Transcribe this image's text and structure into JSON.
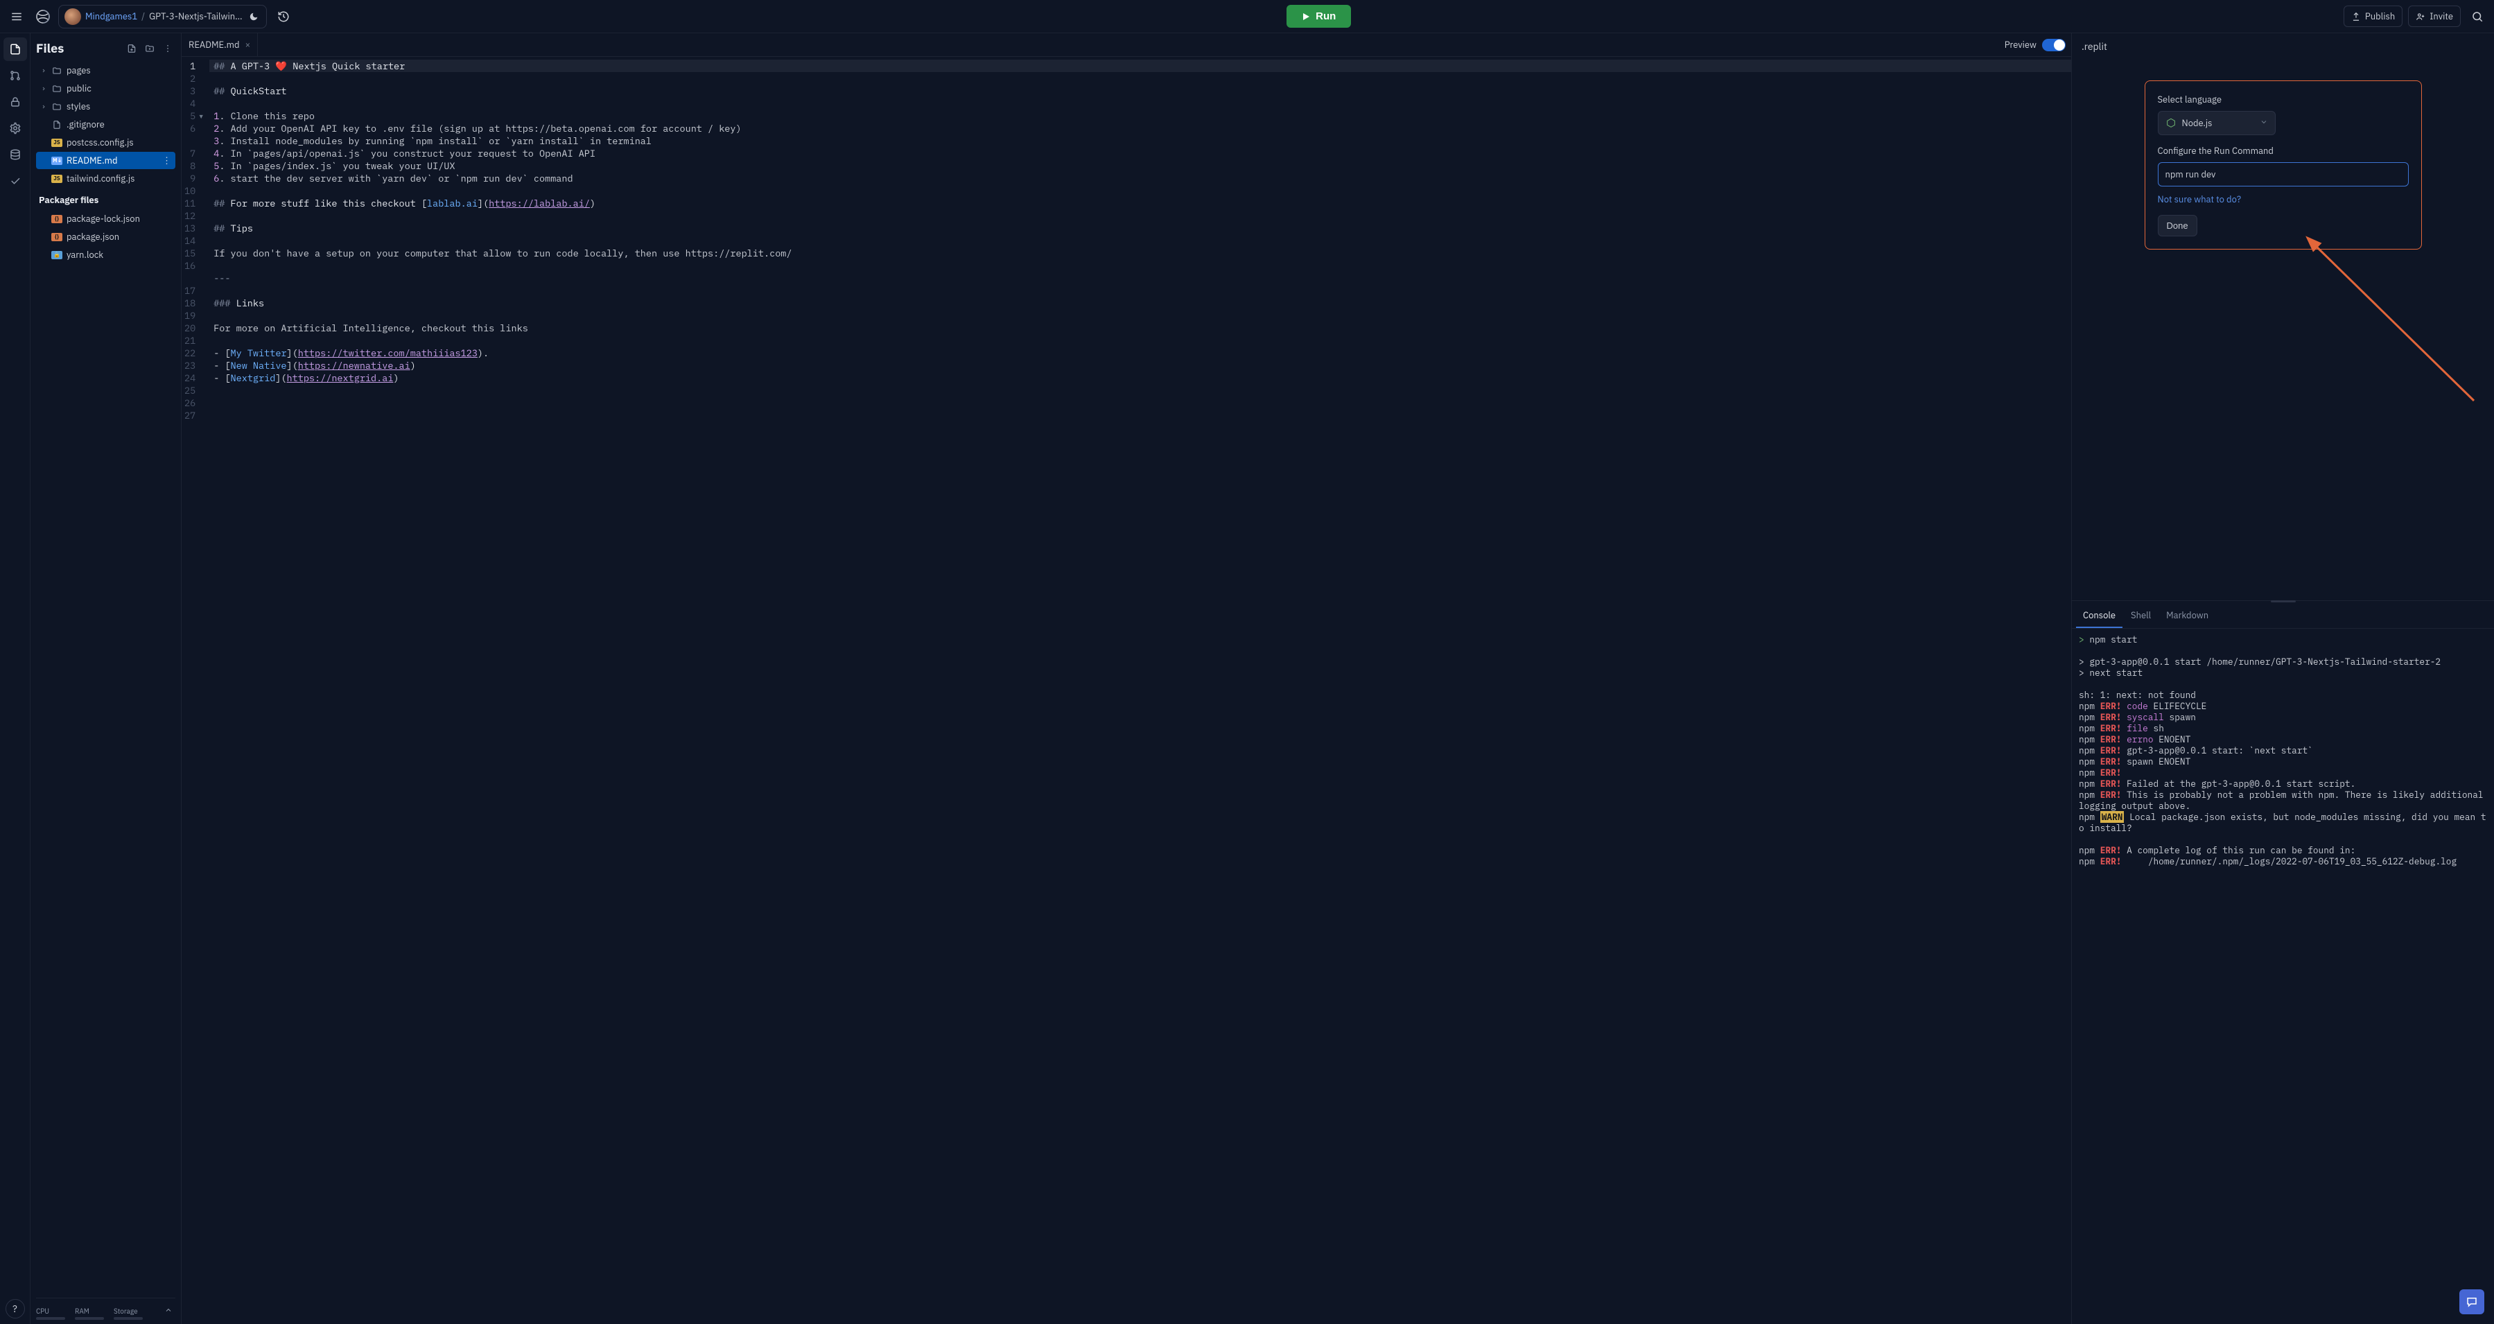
{
  "header": {
    "user": "Mindgames1",
    "repo": "GPT-3-Nextjs-Tailwin…",
    "run": "Run",
    "publish": "Publish",
    "invite": "Invite"
  },
  "files": {
    "title": "Files",
    "folders": [
      "pages",
      "public",
      "styles"
    ],
    "loose": [
      {
        "name": ".gitignore",
        "badge": "",
        "kind": "plain"
      },
      {
        "name": "postcss.config.js",
        "badge": "JS",
        "kind": "js"
      },
      {
        "name": "README.md",
        "badge": "M↓",
        "kind": "md",
        "selected": true
      },
      {
        "name": "tailwind.config.js",
        "badge": "JS",
        "kind": "js"
      }
    ],
    "packager_label": "Packager files",
    "packager": [
      {
        "name": "package-lock.json",
        "badge": "{}",
        "kind": "json"
      },
      {
        "name": "package.json",
        "badge": "{}",
        "kind": "json"
      },
      {
        "name": "yarn.lock",
        "badge": "🔒",
        "kind": "lock"
      }
    ],
    "footer": {
      "cpu": "CPU",
      "ram": "RAM",
      "storage": "Storage"
    }
  },
  "editor": {
    "tab": "README.md",
    "preview": "Preview",
    "lines": [
      {
        "n": 1,
        "segs": [
          {
            "t": "## ",
            "c": "c-mk"
          },
          {
            "t": "A GPT-3 ",
            "c": "c-head"
          },
          {
            "t": "❤️",
            "c": "heart"
          },
          {
            "t": " Nextjs Quick starter",
            "c": "c-head"
          }
        ],
        "cur": true
      },
      {
        "n": 2,
        "segs": []
      },
      {
        "n": 3,
        "segs": [
          {
            "t": "## ",
            "c": "c-mk"
          },
          {
            "t": "QuickStart",
            "c": "c-head"
          }
        ]
      },
      {
        "n": 4,
        "segs": []
      },
      {
        "n": 5,
        "segs": [
          {
            "t": "1",
            "c": "c-num"
          },
          {
            "t": ". Clone this repo",
            "c": ""
          }
        ],
        "fold": true
      },
      {
        "n": 6,
        "segs": [
          {
            "t": "2",
            "c": "c-num"
          },
          {
            "t": ". Add your OpenAI API key to .env file (sign up at https://beta.openai.com for account / key)",
            "c": ""
          }
        ],
        "wrap": true
      },
      {
        "n": 7,
        "segs": [
          {
            "t": "3",
            "c": "c-num"
          },
          {
            "t": ". Install node_modules by running `npm install` or `yarn install` in terminal",
            "c": ""
          }
        ]
      },
      {
        "n": 8,
        "segs": [
          {
            "t": "4",
            "c": "c-num"
          },
          {
            "t": ". In `pages/api/openai.js` you construct your request to OpenAI API",
            "c": ""
          }
        ]
      },
      {
        "n": 9,
        "segs": [
          {
            "t": "5",
            "c": "c-num"
          },
          {
            "t": ". In `pages/index.js` you tweak your UI/UX",
            "c": ""
          }
        ]
      },
      {
        "n": 10,
        "segs": [
          {
            "t": "6",
            "c": "c-num"
          },
          {
            "t": ". start the dev server with `yarn dev` or `npm run dev` command",
            "c": ""
          }
        ]
      },
      {
        "n": 11,
        "segs": []
      },
      {
        "n": 12,
        "segs": [
          {
            "t": "## ",
            "c": "c-mk"
          },
          {
            "t": "For more stuff like this checkout ",
            "c": "c-head"
          },
          {
            "t": "[",
            "c": "c-br"
          },
          {
            "t": "lablab.ai",
            "c": "c-linktext"
          },
          {
            "t": "](",
            "c": "c-br"
          },
          {
            "t": "https://lablab.ai/",
            "c": "c-link"
          },
          {
            "t": ")",
            "c": "c-br"
          }
        ]
      },
      {
        "n": 13,
        "segs": []
      },
      {
        "n": 14,
        "segs": [
          {
            "t": "## ",
            "c": "c-mk"
          },
          {
            "t": "Tips",
            "c": "c-head"
          }
        ]
      },
      {
        "n": 15,
        "segs": []
      },
      {
        "n": 16,
        "segs": [
          {
            "t": "If you don't have a setup on your computer that allow to run code locally, then use https://replit.com/",
            "c": ""
          }
        ],
        "wrap": true
      },
      {
        "n": 17,
        "segs": []
      },
      {
        "n": 18,
        "segs": [
          {
            "t": "---",
            "c": "c-mk"
          }
        ]
      },
      {
        "n": 19,
        "segs": []
      },
      {
        "n": 20,
        "segs": [
          {
            "t": "### ",
            "c": "c-mk"
          },
          {
            "t": "Links",
            "c": "c-head"
          }
        ]
      },
      {
        "n": 21,
        "segs": []
      },
      {
        "n": 22,
        "segs": [
          {
            "t": "For more on Artificial Intelligence, checkout this links",
            "c": ""
          }
        ]
      },
      {
        "n": 23,
        "segs": []
      },
      {
        "n": 24,
        "segs": [
          {
            "t": "- ",
            "c": ""
          },
          {
            "t": "[",
            "c": "c-br"
          },
          {
            "t": "My Twitter",
            "c": "c-linktext"
          },
          {
            "t": "](",
            "c": "c-br"
          },
          {
            "t": "https://twitter.com/mathiiias123",
            "c": "c-link"
          },
          {
            "t": ")",
            "c": "c-br"
          },
          {
            "t": ".",
            "c": ""
          }
        ]
      },
      {
        "n": 25,
        "segs": [
          {
            "t": "- ",
            "c": ""
          },
          {
            "t": "[",
            "c": "c-br"
          },
          {
            "t": "New Native",
            "c": "c-linktext"
          },
          {
            "t": "](",
            "c": "c-br"
          },
          {
            "t": "https://newnative.ai",
            "c": "c-link"
          },
          {
            "t": ")",
            "c": "c-br"
          }
        ]
      },
      {
        "n": 26,
        "segs": [
          {
            "t": "- ",
            "c": ""
          },
          {
            "t": "[",
            "c": "c-br"
          },
          {
            "t": "Nextgrid",
            "c": "c-linktext"
          },
          {
            "t": "](",
            "c": "c-br"
          },
          {
            "t": "https://nextgrid.ai",
            "c": "c-link"
          },
          {
            "t": ")",
            "c": "c-br"
          }
        ]
      },
      {
        "n": 27,
        "segs": []
      }
    ]
  },
  "replit": {
    "tab": ".replit",
    "select_label": "Select language",
    "language": "Node.js",
    "configure_label": "Configure the Run Command",
    "run_command": "npm run dev",
    "help": "Not sure what to do?",
    "done": "Done"
  },
  "console": {
    "tabs": [
      "Console",
      "Shell",
      "Markdown"
    ],
    "lines": [
      {
        "segs": [
          {
            "t": "> ",
            "c": "prompt-ch"
          },
          {
            "t": "npm start"
          }
        ]
      },
      {
        "segs": []
      },
      {
        "segs": [
          {
            "t": "> gpt-3-app@0.0.1 start /home/runner/GPT-3-Nextjs-Tailwind-starter-2"
          }
        ]
      },
      {
        "segs": [
          {
            "t": "> next start"
          }
        ]
      },
      {
        "segs": []
      },
      {
        "segs": [
          {
            "t": "sh: 1: next: not found"
          }
        ]
      },
      {
        "segs": [
          {
            "t": "npm "
          },
          {
            "t": "ERR!",
            "c": "err"
          },
          {
            "t": " "
          },
          {
            "t": "code",
            "c": "errkey"
          },
          {
            "t": " ELIFECYCLE"
          }
        ]
      },
      {
        "segs": [
          {
            "t": "npm "
          },
          {
            "t": "ERR!",
            "c": "err"
          },
          {
            "t": " "
          },
          {
            "t": "syscall",
            "c": "errkey"
          },
          {
            "t": " spawn"
          }
        ]
      },
      {
        "segs": [
          {
            "t": "npm "
          },
          {
            "t": "ERR!",
            "c": "err"
          },
          {
            "t": " "
          },
          {
            "t": "file",
            "c": "errkey"
          },
          {
            "t": " sh"
          }
        ]
      },
      {
        "segs": [
          {
            "t": "npm "
          },
          {
            "t": "ERR!",
            "c": "err"
          },
          {
            "t": " "
          },
          {
            "t": "errno",
            "c": "errkey"
          },
          {
            "t": " ENOENT"
          }
        ]
      },
      {
        "segs": [
          {
            "t": "npm "
          },
          {
            "t": "ERR!",
            "c": "err"
          },
          {
            "t": " gpt-3-app@0.0.1 start: `next start`"
          }
        ]
      },
      {
        "segs": [
          {
            "t": "npm "
          },
          {
            "t": "ERR!",
            "c": "err"
          },
          {
            "t": " spawn ENOENT"
          }
        ]
      },
      {
        "segs": [
          {
            "t": "npm "
          },
          {
            "t": "ERR!",
            "c": "err"
          }
        ]
      },
      {
        "segs": [
          {
            "t": "npm "
          },
          {
            "t": "ERR!",
            "c": "err"
          },
          {
            "t": " Failed at the gpt-3-app@0.0.1 start script."
          }
        ]
      },
      {
        "segs": [
          {
            "t": "npm "
          },
          {
            "t": "ERR!",
            "c": "err"
          },
          {
            "t": " This is probably not a problem with npm. There is likely additional logging output above."
          }
        ]
      },
      {
        "segs": [
          {
            "t": "npm "
          },
          {
            "t": "WARN",
            "c": "warn"
          },
          {
            "t": " Local package.json exists, but node_modules missing, did you mean to install?"
          }
        ]
      },
      {
        "segs": []
      },
      {
        "segs": [
          {
            "t": "npm "
          },
          {
            "t": "ERR!",
            "c": "err"
          },
          {
            "t": " A complete log of this run can be found in:"
          }
        ]
      },
      {
        "segs": [
          {
            "t": "npm "
          },
          {
            "t": "ERR!",
            "c": "err"
          },
          {
            "t": "     /home/runner/.npm/_logs/2022-07-06T19_03_55_612Z-debug.log"
          }
        ]
      }
    ]
  }
}
